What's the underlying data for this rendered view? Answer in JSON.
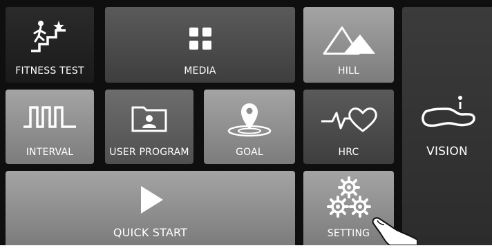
{
  "tiles": {
    "fitness_test": {
      "label": "FITNESS TEST",
      "icon": "stairs-climber-icon"
    },
    "media": {
      "label": "MEDIA",
      "icon": "grid-icon"
    },
    "hill": {
      "label": "HILL",
      "icon": "mountains-icon"
    },
    "interval": {
      "label": "INTERVAL",
      "icon": "square-wave-icon"
    },
    "user_program": {
      "label": "USER PROGRAM",
      "icon": "user-folder-icon"
    },
    "goal": {
      "label": "GOAL",
      "icon": "location-pin-icon"
    },
    "hrc": {
      "label": "HRC",
      "icon": "heartbeat-icon"
    },
    "vision": {
      "label": "VISION",
      "icon": "lake-route-icon"
    },
    "quick_start": {
      "label": "QUICK START",
      "icon": "play-icon"
    },
    "setting": {
      "label": "SETTING",
      "icon": "gears-icon"
    }
  },
  "colors": {
    "background": "#0f0f0f",
    "text": "#ffffff"
  }
}
